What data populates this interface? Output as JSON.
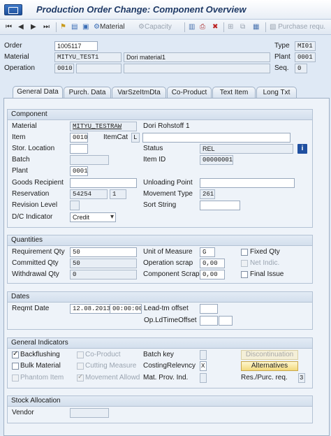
{
  "window": {
    "title": "Production Order Change: Component Overview"
  },
  "toolbar": {
    "material_label": "Material",
    "capacity_label": "Capacity",
    "purchase_label": "Purchase requ."
  },
  "header": {
    "order_label": "Order",
    "order_value": "1005117",
    "type_label": "Type",
    "type_value": "MI01",
    "material_label": "Material",
    "material_value": "MITYU_TEST1",
    "material_desc": "Dori material1",
    "plant_label": "Plant",
    "plant_value": "0001",
    "operation_label": "Operation",
    "operation_value": "0010",
    "seq_label": "Seq.",
    "seq_value": "0"
  },
  "tabs": [
    {
      "label": "General Data",
      "active": true
    },
    {
      "label": "Purch. Data"
    },
    {
      "label": "VarSzeItmDta"
    },
    {
      "label": "Co-Product"
    },
    {
      "label": "Text Item"
    },
    {
      "label": "Long Txt"
    }
  ],
  "component": {
    "title": "Component",
    "material_label": "Material",
    "material_value": "MITYU_TESTRAW",
    "material_desc": "Dori Rohstoff 1",
    "item_label": "Item",
    "item_value": "0010",
    "itemcat_label": "ItemCat",
    "itemcat_value": "L",
    "stor_location_label": "Stor. Location",
    "status_label": "Status",
    "status_value": "REL",
    "batch_label": "Batch",
    "item_id_label": "Item ID",
    "item_id_value": "00000001",
    "plant_label": "Plant",
    "plant_value": "0001",
    "goods_recipient_label": "Goods Recipient",
    "unloading_point_label": "Unloading Point",
    "reservation_label": "Reservation",
    "reservation_value": "54254",
    "reservation_item": "1",
    "movement_type_label": "Movement Type",
    "movement_type_value": "261",
    "revision_level_label": "Revision Level",
    "sort_string_label": "Sort String",
    "dc_indicator_label": "D/C Indicator",
    "dc_indicator_value": "Credit"
  },
  "quantities": {
    "title": "Quantities",
    "requirement_label": "Requirement Qty",
    "requirement_value": "50",
    "unit_label": "Unit of Measure",
    "unit_value": "G",
    "fixed_qty_label": "Fixed Qty",
    "committed_label": "Committed Qty",
    "committed_value": "50",
    "op_scrap_label": "Operation scrap",
    "op_scrap_value": "0,00",
    "net_indic_label": "Net Indic.",
    "withdrawal_label": "Withdrawal Qty",
    "withdrawal_value": "0",
    "comp_scrap_label": "Component Scrap",
    "comp_scrap_value": "0,00",
    "final_issue_label": "Final Issue"
  },
  "dates": {
    "title": "Dates",
    "reqmt_date_label": "Reqmt Date",
    "reqmt_date_value": "12.08.2013",
    "reqmt_time_value": "00:00:00",
    "lead_tm_offset_label": "Lead-tm offset",
    "op_ld_time_offset_label": "Op.LdTimeOffset"
  },
  "general_indicators": {
    "title": "General Indicators",
    "backflushing_label": "Backflushing",
    "co_product_label": "Co-Product",
    "batch_key_label": "Batch key",
    "discontinuation_label": "Discontinuation",
    "bulk_material_label": "Bulk Material",
    "cutting_measure_label": "Cutting Measure",
    "costing_relevancy_label": "CostingRelevncy",
    "costing_relevancy_value": "X",
    "alternatives_label": "Alternatives",
    "phantom_item_label": "Phantom Item",
    "movement_allowed_label": "Movement Allowd",
    "mat_prov_ind_label": "Mat. Prov. Ind.",
    "res_purc_req_label": "Res./Purc. req.",
    "res_purc_req_value": "3"
  },
  "stock_allocation": {
    "title": "Stock Allocation",
    "vendor_label": "Vendor"
  }
}
